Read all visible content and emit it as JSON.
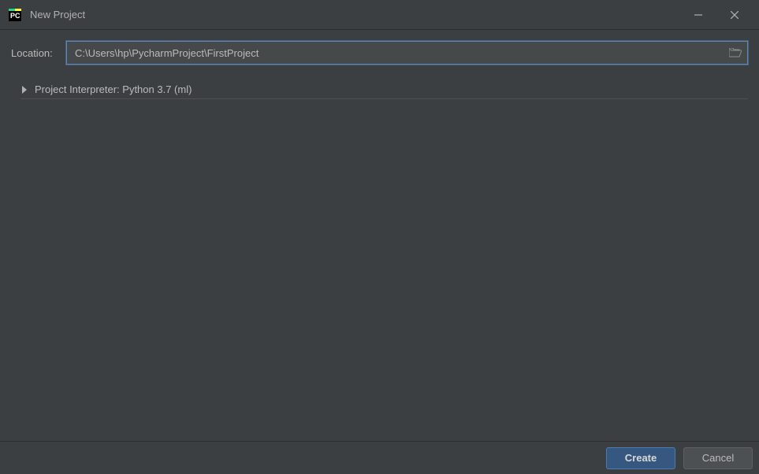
{
  "window": {
    "title": "New Project"
  },
  "form": {
    "location_label": "Location:",
    "location_value": "C:\\Users\\hp\\PycharmProject\\FirstProject",
    "interpreter_label": "Project Interpreter: Python 3.7 (ml)"
  },
  "buttons": {
    "create": "Create",
    "cancel": "Cancel"
  }
}
